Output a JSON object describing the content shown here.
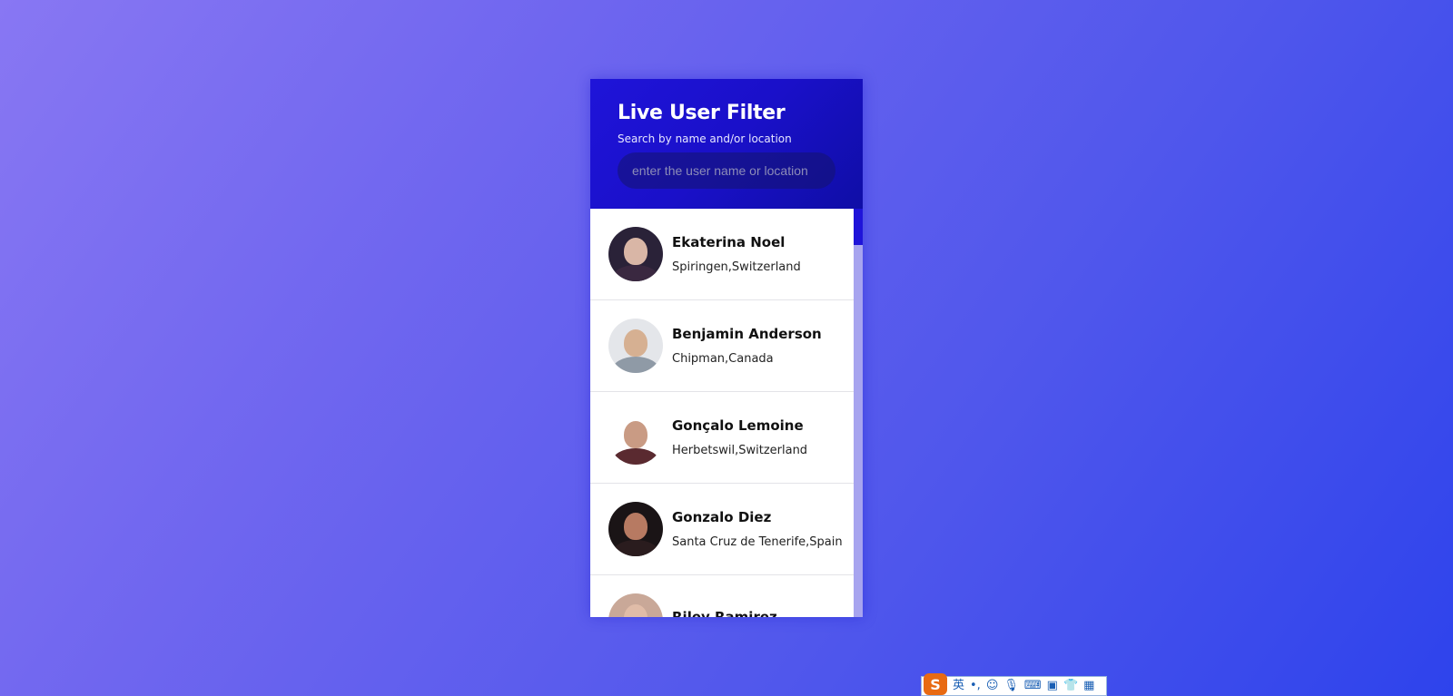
{
  "app": {
    "title": "Live User Filter",
    "subtitle": "Search by name and/or location",
    "search_placeholder": "enter the user name or location"
  },
  "users": [
    {
      "name": "Ekaterina Noel",
      "location": "Spiringen,Switzerland"
    },
    {
      "name": "Benjamin Anderson",
      "location": "Chipman,Canada"
    },
    {
      "name": "Gonçalo Lemoine",
      "location": "Herbetswil,Switzerland"
    },
    {
      "name": "Gonzalo Diez",
      "location": "Santa Cruz de Tenerife,Spain"
    },
    {
      "name": "Riley Ramirez",
      "location": ""
    }
  ],
  "ime_toolbar": {
    "logo": "S",
    "mode_label": "英",
    "punct_label": "•,",
    "icons": [
      "emoji-icon",
      "microphone-icon",
      "keyboard-icon",
      "toolbox-icon",
      "skin-icon",
      "grid-icon"
    ]
  },
  "colors": {
    "header_bg": "#1f14d9",
    "scrollbar_track": "#a7a4ef",
    "scrollbar_thumb": "#1f14d9"
  }
}
